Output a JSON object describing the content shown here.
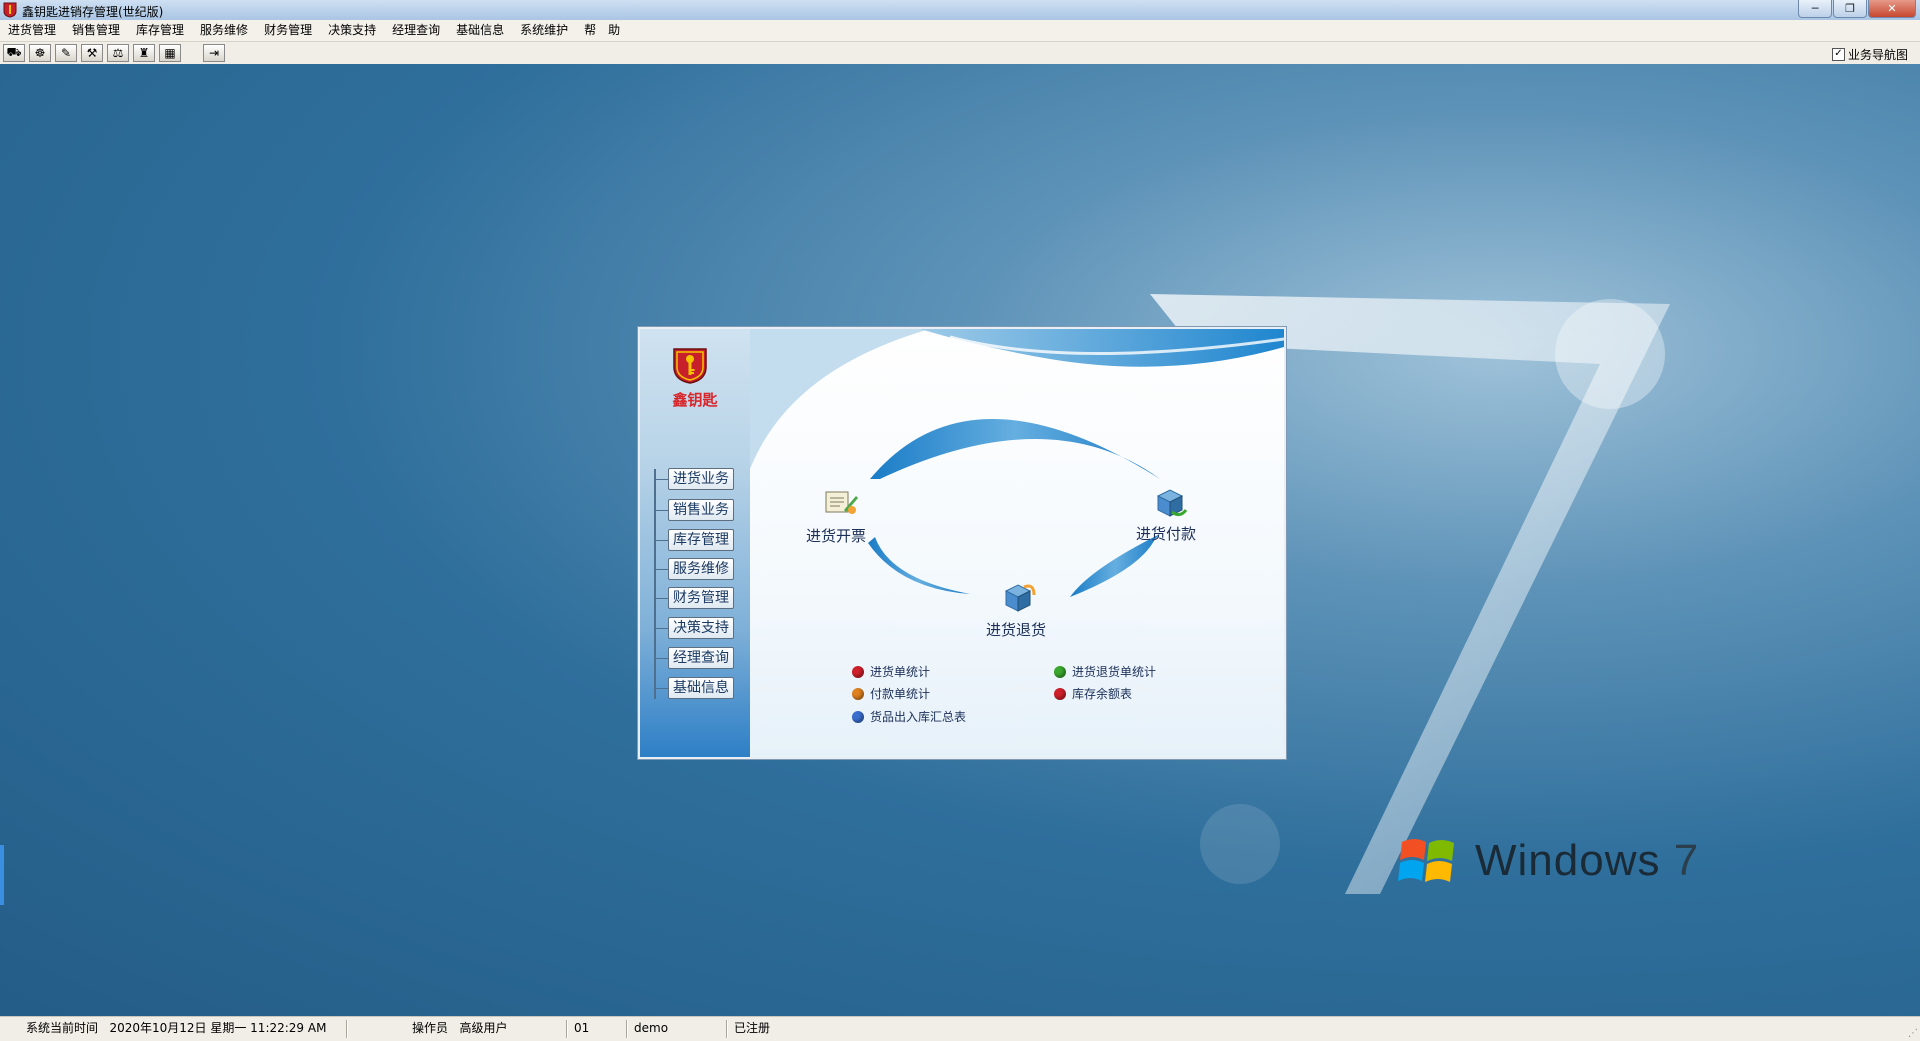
{
  "window": {
    "title": "鑫钥匙进销存管理(世纪版)",
    "buttons": {
      "minimize": "─",
      "maximize": "❐",
      "close": "✕"
    }
  },
  "menu": {
    "items": [
      "进货管理",
      "销售管理",
      "库存管理",
      "服务维修",
      "财务管理",
      "决策支持",
      "经理查询",
      "基础信息",
      "系统维护",
      "帮　助"
    ]
  },
  "toolbar": {
    "buttons": [
      {
        "icon": "purchase-icon",
        "glyph": "⛟"
      },
      {
        "icon": "sales-icon",
        "glyph": "☸"
      },
      {
        "icon": "inventory-icon",
        "glyph": "✎"
      },
      {
        "icon": "service-icon",
        "glyph": "⚒"
      },
      {
        "icon": "finance-icon",
        "glyph": "⚖"
      },
      {
        "icon": "decision-icon",
        "glyph": "♜"
      },
      {
        "icon": "calculator-icon",
        "glyph": "▦"
      },
      {
        "icon": "exit-icon",
        "glyph": "⇥"
      }
    ],
    "nav_checkbox_label": "业务导航图",
    "nav_checkbox_checked": true
  },
  "desktop": {
    "brand_text": "Windows",
    "brand_version": "7",
    "colors": {
      "logo_red": "#f25022",
      "logo_green": "#7fba00",
      "logo_blue": "#00a4ef",
      "logo_yellow": "#ffb900"
    }
  },
  "panel": {
    "logo_text": "鑫钥匙",
    "side_buttons": [
      "进货业务",
      "销售业务",
      "库存管理",
      "服务维修",
      "财务管理",
      "决策支持",
      "经理查询",
      "基础信息"
    ],
    "flow": {
      "invoice_label": "进货开票",
      "payment_label": "进货付款",
      "return_label": "进货退货"
    },
    "reports": [
      {
        "label": "进货单统计",
        "color": "#d0202a"
      },
      {
        "label": "进货退货单统计",
        "color": "#3aa82e"
      },
      {
        "label": "付款单统计",
        "color": "#e0821e"
      },
      {
        "label": "库存余额表",
        "color": "#d0202a"
      },
      {
        "label": "货品出入库汇总表",
        "color": "#3a6fd0"
      }
    ]
  },
  "status": {
    "time_label": "系统当前时间",
    "datetime": "2020年10月12日 星期一 11:22:29 AM",
    "operator_label": "操作员",
    "operator_value": "高级用户",
    "code": "01",
    "user": "demo",
    "registration": "已注册"
  }
}
